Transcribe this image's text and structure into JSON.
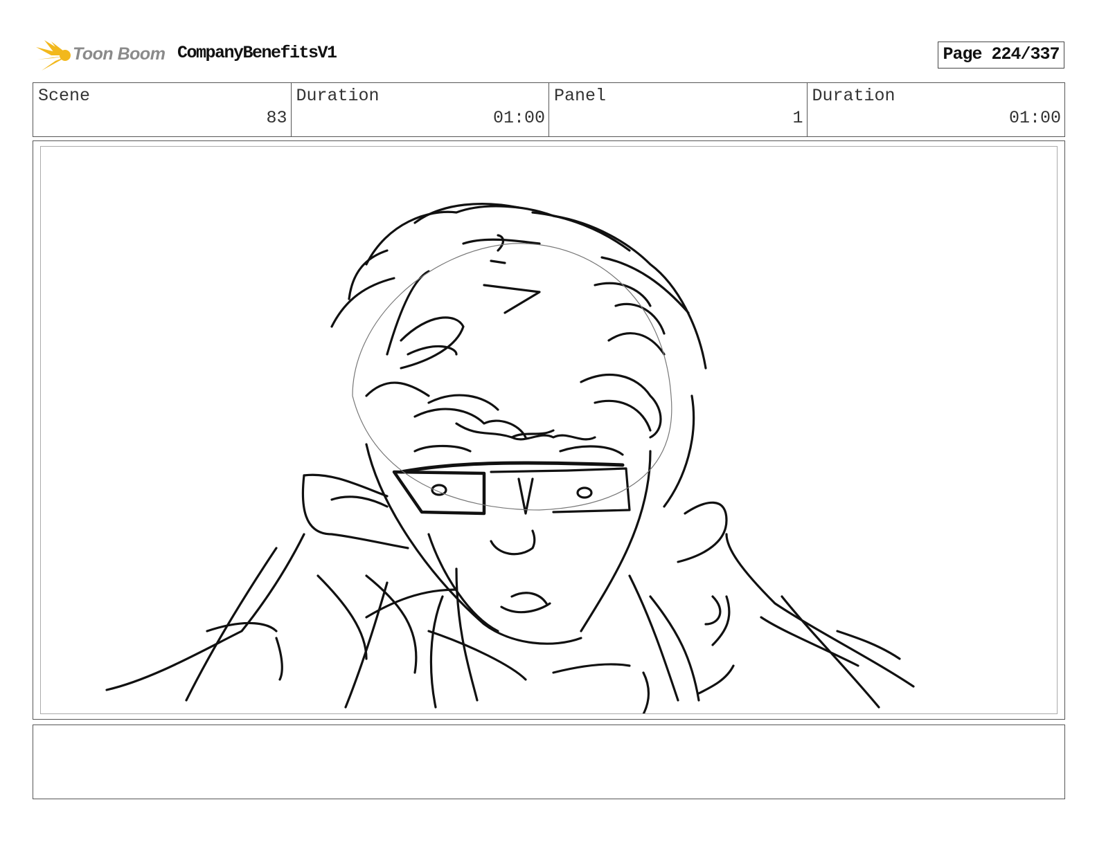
{
  "header": {
    "logo_text": "Toon Boom",
    "project_title": "CompanyBenefitsV1",
    "page_label": "Page 224/337"
  },
  "info": {
    "scene_label": "Scene",
    "scene_value": "83",
    "scene_duration_label": "Duration",
    "scene_duration_value": "01:00",
    "panel_label": "Panel",
    "panel_value": "1",
    "panel_duration_label": "Duration",
    "panel_duration_value": "01:00"
  },
  "colors": {
    "logo_star": "#f2b81c",
    "logo_text": "#8a8a8a",
    "sketch_line": "#111111"
  },
  "panel": {
    "sketch_icon": "character-sketch-icon"
  },
  "notes": {
    "text": ""
  }
}
